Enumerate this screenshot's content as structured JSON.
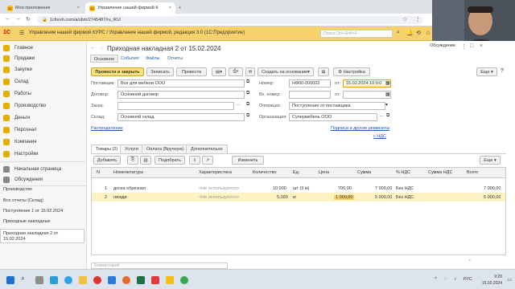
{
  "browser": {
    "tabs": [
      {
        "label": "Мои приложения"
      },
      {
        "label": "Управление нашей фирмой К"
      }
    ],
    "url": "1cfresh.com/a/sbm/2745487/ru_RU/"
  },
  "app": {
    "logo": "1С",
    "title": "Управление нашей фирмой КУРС / Управление нашей фирмой, редакция 3.0  (1С:Предприятие)",
    "search_placeholder": "Поиск Ctrl+Shift+F"
  },
  "sidebar": {
    "items": [
      "Продажи",
      "Закупки",
      "Склад",
      "Работы",
      "Производство",
      "Деньги",
      "Персонал",
      "Компания",
      "Настройки"
    ],
    "links": [
      "Начальная страница",
      "Обсуждения"
    ],
    "history": [
      "Производство",
      "Все отчеты (Склад)",
      "Поступление 1 от 15.02.2024",
      "Приходные накладные",
      "Приходная накладная 2 от 15.02.2024"
    ]
  },
  "form": {
    "title": "Приходная накладная 2 от 15.02.2024",
    "discussion": "Обсуждение",
    "tabs": [
      "Основное",
      "События",
      "Файлы",
      "Отчеты"
    ],
    "toolbar": {
      "post_close": "Провести и закрыть",
      "save": "Записать",
      "post": "Провести",
      "create_basis": "Создать на основании",
      "settings": "Настройка",
      "more": "Еще"
    },
    "fields": {
      "supplier_label": "Поставщик:",
      "supplier": "Все для мебели ООО",
      "contract_label": "Договор:",
      "contract": "Основной договор",
      "order_label": "Заказ:",
      "order": "",
      "warehouse_label": "Склад:",
      "warehouse": "Основной склад",
      "number_label": "Номер:",
      "number": "НФ00-000002",
      "date_label": "от:",
      "date": "15.02.2024 10:0:0",
      "inno_label": "Вх. номер:",
      "inno": "",
      "inno_date_label": "от:",
      "inno_date": "",
      "operation_label": "Операция:",
      "operation": "Поступление от поставщика",
      "org_label": "Организация:",
      "org": "Супермебель ООО"
    },
    "links": {
      "allocation": "Распределение",
      "signatures": "Подписи и другие реквизиты",
      "vat": "с НДС"
    },
    "table_tabs": [
      "Товары (2)",
      "Услуги",
      "Оплата (Вручную)",
      "Дополнительно"
    ],
    "table_toolbar": {
      "add": "Добавить",
      "select": "Подобрать",
      "change": "Изменить",
      "more": "Еще"
    },
    "columns": [
      "N",
      "Номенклатура",
      "Характеристика",
      "Количество",
      "Ед.",
      "Цена",
      "Сумма",
      "% НДС",
      "Сумма НДС",
      "Всего"
    ],
    "rows": [
      {
        "n": "1",
        "item": "доска обрезная",
        "char": "<Не используются>",
        "qty": "10,000",
        "unit": "шт (3 м)",
        "price": "700,00",
        "sum": "7 000,00",
        "vat": "Без НДС",
        "vatsum": "",
        "total": "7 000,00"
      },
      {
        "n": "2",
        "item": "гвозди",
        "char": "<Не используются>",
        "qty": "5,000",
        "unit": "кг",
        "price": "1 000,00",
        "sum": "5 000,00",
        "vat": "Без НДС",
        "vatsum": "",
        "total": "5 000,00"
      }
    ],
    "comment_placeholder": "Комментарий"
  },
  "taskbar": {
    "time": "9:20",
    "date": "15.02.2024",
    "lang": "РУС"
  },
  "colors": {
    "accent": "#fbe27a",
    "header": "#f7d26a",
    "link": "#1e5ba8",
    "selected_row": "#fcf2c4"
  }
}
